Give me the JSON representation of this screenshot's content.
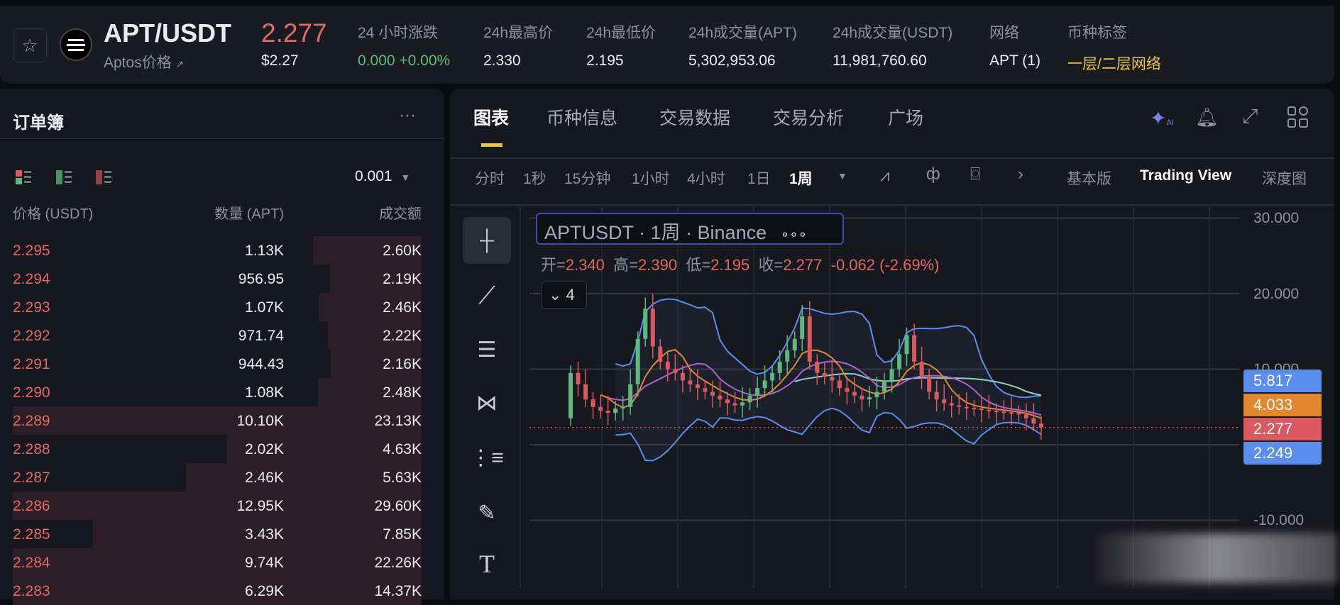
{
  "header": {
    "pair": "APT/USDT",
    "subtitle": "Aptos价格",
    "subtitle_icon": "↗",
    "price": "2.277",
    "price_usd": "$2.27",
    "stats": [
      {
        "label": "24 小时涨跌",
        "value": "0.000 +0.00%",
        "color": "#5fb87f"
      },
      {
        "label": "24h最高价",
        "value": "2.330"
      },
      {
        "label": "24h最低价",
        "value": "2.195"
      },
      {
        "label": "24h成交量(APT)",
        "value": "5,302,953.06"
      },
      {
        "label": "24h成交量(USDT)",
        "value": "11,981,760.60"
      },
      {
        "label": "网络",
        "value": "APT (1)"
      },
      {
        "label": "币种标签",
        "value": "一层/二层网络",
        "color": "#e8c547"
      }
    ]
  },
  "orderbook": {
    "title": "订单簿",
    "more": "···",
    "precision": "0.001",
    "columns": [
      "价格 (USDT)",
      "数量 (APT)",
      "成交额"
    ],
    "rows": [
      {
        "price": "2.295",
        "qty": "1.13K",
        "total": "2.60K",
        "depth": 0.266
      },
      {
        "price": "2.294",
        "qty": "956.95",
        "total": "2.19K",
        "depth": 0.224
      },
      {
        "price": "2.293",
        "qty": "1.07K",
        "total": "2.46K",
        "depth": 0.252
      },
      {
        "price": "2.292",
        "qty": "971.74",
        "total": "2.22K",
        "depth": 0.229
      },
      {
        "price": "2.291",
        "qty": "944.43",
        "total": "2.16K",
        "depth": 0.222
      },
      {
        "price": "2.290",
        "qty": "1.08K",
        "total": "2.48K",
        "depth": 0.253
      },
      {
        "price": "2.289",
        "qty": "10.10K",
        "total": "23.13K",
        "depth": 1.0
      },
      {
        "price": "2.288",
        "qty": "2.02K",
        "total": "4.63K",
        "depth": 0.476
      },
      {
        "price": "2.287",
        "qty": "2.46K",
        "total": "5.63K",
        "depth": 0.576
      },
      {
        "price": "2.286",
        "qty": "12.95K",
        "total": "29.60K",
        "depth": 1.0
      },
      {
        "price": "2.285",
        "qty": "3.43K",
        "total": "7.85K",
        "depth": 0.804
      },
      {
        "price": "2.284",
        "qty": "9.74K",
        "total": "22.26K",
        "depth": 1.0
      },
      {
        "price": "2.283",
        "qty": "6.29K",
        "total": "14.37K",
        "depth": 1.0
      }
    ]
  },
  "tabs": [
    "图表",
    "币种信息",
    "交易数据",
    "交易分析",
    "广场"
  ],
  "intervals": [
    "分时",
    "1秒",
    "15分钟",
    "1小时",
    "4小时",
    "1日",
    "1周"
  ],
  "toolbar_right": [
    "基本版",
    "Trading View",
    "深度图"
  ],
  "legend": {
    "title": "APTUSDT · 1周 · Binance",
    "more": "∘∘∘",
    "o_label": "开=",
    "o": "2.340",
    "h_label": "高=",
    "h": "2.390",
    "l_label": "低=",
    "l": "2.195",
    "c_label": "收=",
    "c": "2.277",
    "change": "-0.062 (-2.69%)",
    "indicators": "4"
  },
  "chart_data": {
    "type": "candlestick",
    "symbol": "APTUSDT",
    "interval": "1周",
    "ylim": [
      -12,
      32
    ],
    "yticks": [
      "30.000",
      "20.000",
      "10.000",
      "-10.000"
    ],
    "ytick_values": [
      30,
      20,
      10,
      -10
    ],
    "closes": [
      9.5,
      8,
      6,
      5,
      4.5,
      4.2,
      4.8,
      5,
      8,
      14,
      18,
      13,
      11,
      10,
      9.5,
      8.5,
      8,
      7.5,
      7,
      6.5,
      6,
      5.5,
      5.2,
      5.6,
      6.5,
      7.5,
      8.5,
      9.5,
      11,
      12.5,
      14,
      17,
      11,
      9.5,
      9,
      8.5,
      7.5,
      7,
      6.5,
      6,
      6.3,
      7,
      8.5,
      10,
      12,
      14.5,
      11,
      9,
      7,
      6,
      5.5,
      5.2,
      5,
      4.9,
      4.8,
      4.6,
      4.5,
      4.4,
      4.3,
      4.2,
      4.0,
      3.5,
      2.8,
      2.277
    ],
    "price_badges": [
      {
        "value": "5.817",
        "color": "#5b8def"
      },
      {
        "value": "4.033",
        "color": "#e0872f"
      },
      {
        "value": "2.277",
        "color": "#d9595f"
      },
      {
        "value": "2.249",
        "color": "#5b8def"
      }
    ]
  }
}
